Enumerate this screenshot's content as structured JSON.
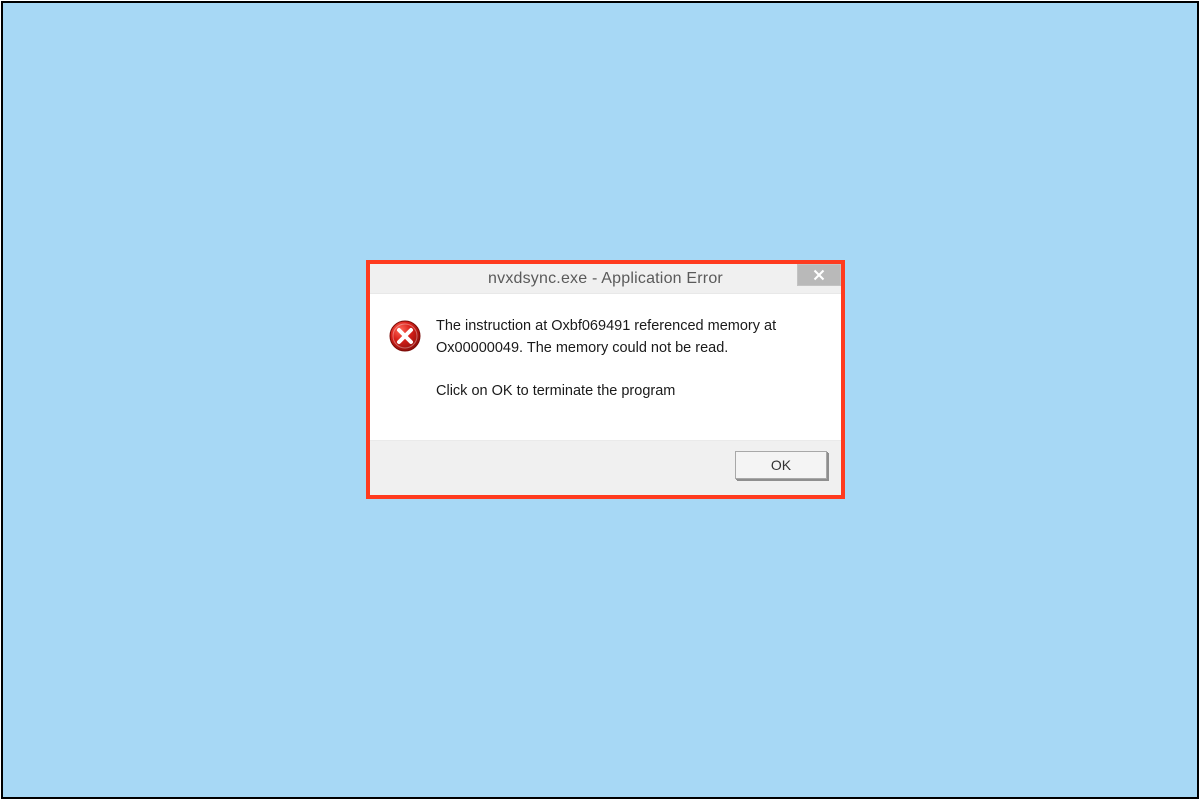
{
  "dialog": {
    "title": "nvxdsync.exe - Application Error",
    "icon": "error-circle-x-icon",
    "message_line1": "The instruction at Oxbf069491 referenced memory at",
    "message_line2": "Ox00000049. The memory could not be read.",
    "message_sub": "Click on OK to terminate the program",
    "close_label": "Close",
    "ok_label": "OK"
  },
  "colors": {
    "backdrop": "#a7d8f5",
    "highlight_border": "#ff3b1f"
  }
}
